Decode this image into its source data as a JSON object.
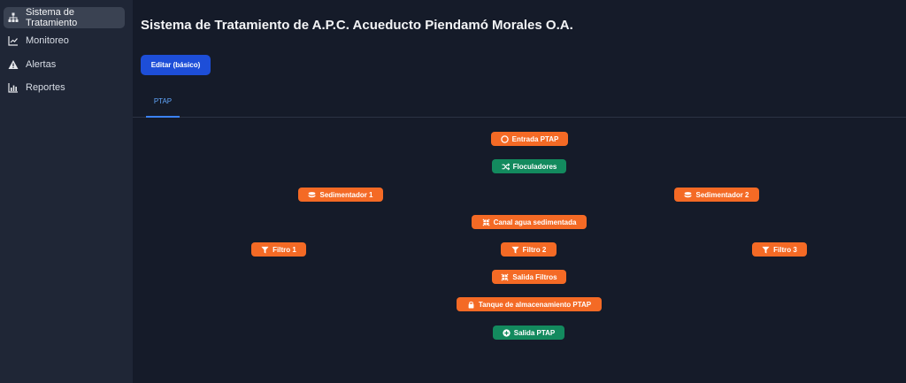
{
  "sidebar": {
    "items": [
      {
        "label": "Sistema de Tratamiento",
        "icon": "sitemap-icon",
        "active": true
      },
      {
        "label": "Monitoreo",
        "icon": "line-chart-icon"
      },
      {
        "label": "Alertas",
        "icon": "warning-icon"
      },
      {
        "label": "Reportes",
        "icon": "bar-chart-icon"
      }
    ]
  },
  "header": {
    "title": "Sistema de Tratamiento de A.P.C. Acueducto Piendamó Morales O.A.",
    "edit_label": "Editar (básico)"
  },
  "tabs": [
    {
      "label": "PTAP",
      "active": true
    }
  ],
  "nodes": {
    "entrada": {
      "label": "Entrada PTAP",
      "icon": "circle-icon"
    },
    "floculadores": {
      "label": "Floculadores",
      "icon": "shuffle-icon"
    },
    "sedimentador1": {
      "label": "Sedimentador 1",
      "icon": "layers-icon"
    },
    "sedimentador2": {
      "label": "Sedimentador 2",
      "icon": "layers-icon"
    },
    "canal": {
      "label": "Canal agua sedimentada",
      "icon": "compress-icon"
    },
    "filtro1": {
      "label": "Filtro 1",
      "icon": "filter-icon"
    },
    "filtro2": {
      "label": "Filtro 2",
      "icon": "filter-icon"
    },
    "filtro3": {
      "label": "Filtro 3",
      "icon": "filter-icon"
    },
    "salida_filtros": {
      "label": "Salida Filtros",
      "icon": "compress-icon"
    },
    "tanque": {
      "label": "Tanque de almacenamiento PTAP",
      "icon": "tank-icon"
    },
    "salida_ptap": {
      "label": "Salida PTAP",
      "icon": "plus-circle-icon"
    }
  },
  "colors": {
    "orange": "#f46a25",
    "green": "#138a5e",
    "accent": "#1d4ed8"
  }
}
